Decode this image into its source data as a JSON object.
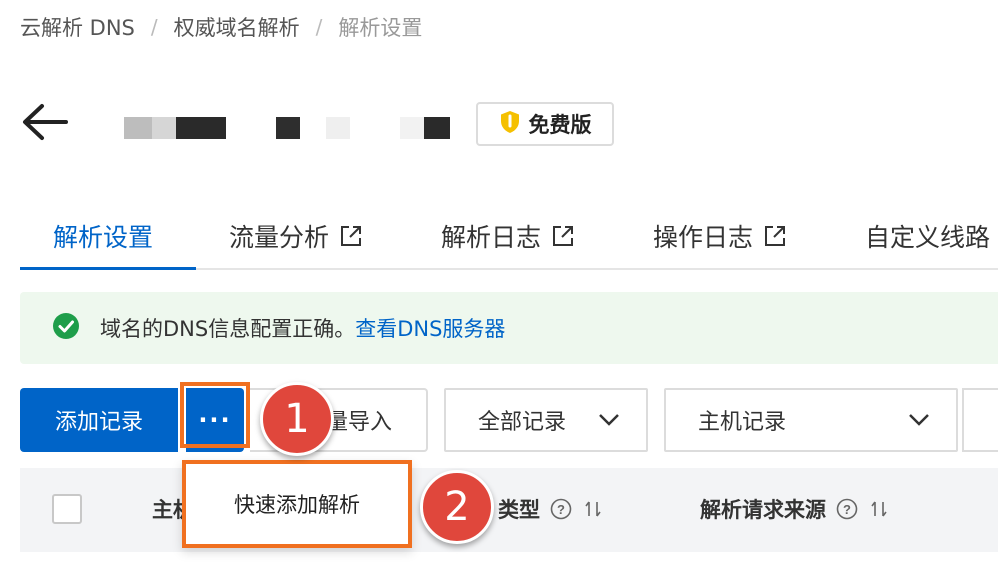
{
  "breadcrumb": [
    "云解析 DNS",
    "权威域名解析",
    "解析设置"
  ],
  "badge": {
    "label": "免费版"
  },
  "tabs": [
    {
      "label": "解析设置",
      "external": false
    },
    {
      "label": "流量分析",
      "external": true
    },
    {
      "label": "解析日志",
      "external": true
    },
    {
      "label": "操作日志",
      "external": true
    },
    {
      "label": "自定义线路",
      "external": false
    }
  ],
  "info": {
    "text": "域名的DNS信息配置正确。",
    "link": "查看DNS服务器"
  },
  "toolbar": {
    "add_label": "添加记录",
    "more_label": "···",
    "import_label": "量导入",
    "filter_record": "全部记录",
    "filter_host": "主机记录"
  },
  "table": {
    "col_host": "主机",
    "col_type": "类型",
    "col_source": "解析请求来源"
  },
  "dropdown": {
    "item": "快速添加解析"
  },
  "steps": [
    "1",
    "2"
  ],
  "colors": {
    "primary": "#0064c8",
    "highlight": "#f07020",
    "step": "#e0473c",
    "success": "#1e9e4a"
  }
}
